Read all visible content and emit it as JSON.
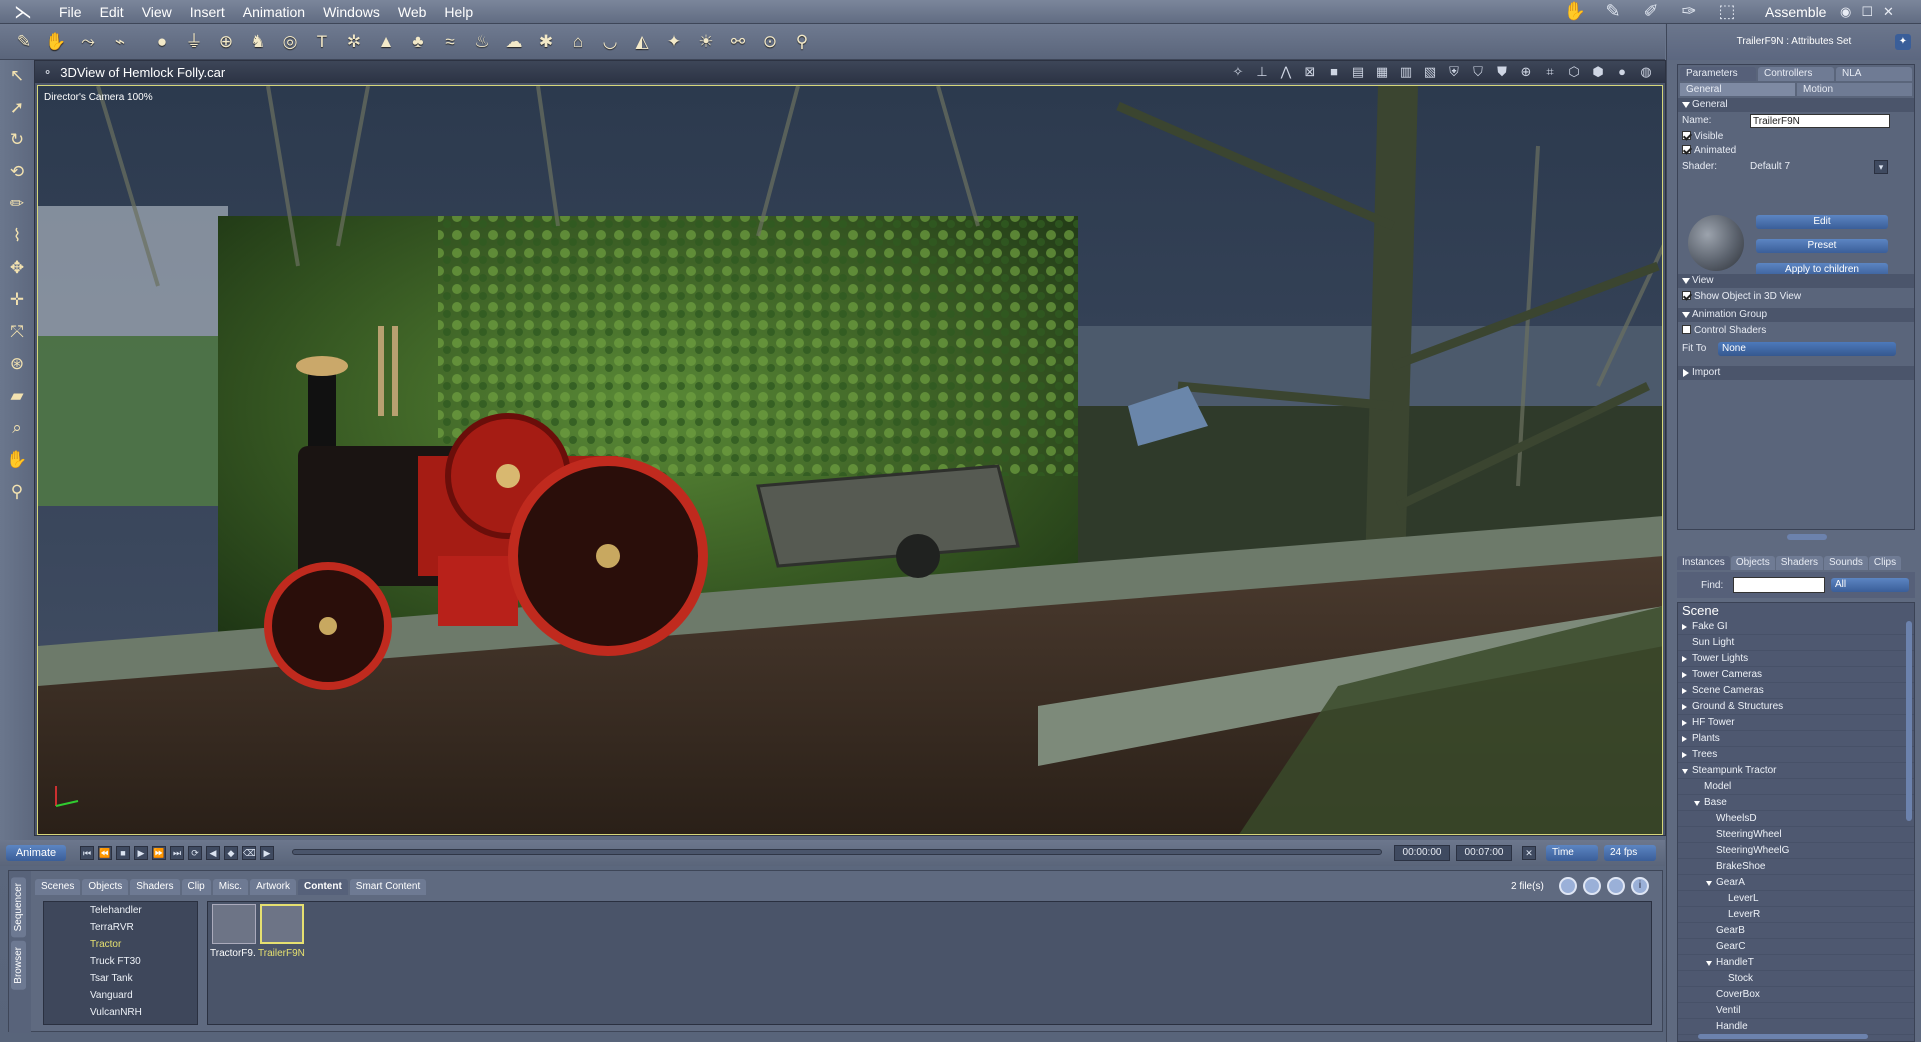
{
  "menu": {
    "items": [
      "File",
      "Edit",
      "View",
      "Insert",
      "Animation",
      "Windows",
      "Web",
      "Help"
    ],
    "room": "Assemble"
  },
  "viewport": {
    "title": "3DView of Hemlock Folly.car",
    "camera": "Director's Camera 100%"
  },
  "attributes": {
    "title": "TrailerF9N : Attributes Set",
    "tabs": [
      "Parameters",
      "Controllers",
      "NLA"
    ],
    "subtabs": [
      "General",
      "Motion"
    ],
    "general_section": "General",
    "name_label": "Name:",
    "name_value": "TrailerF9N",
    "visible_label": "Visible",
    "animated_label": "Animated",
    "shader_label": "Shader:",
    "shader_value": "Default 7",
    "edit_btn": "Edit",
    "preset_btn": "Preset",
    "apply_btn": "Apply to children",
    "view_section": "View",
    "show_object_label": "Show Object in 3D View",
    "anim_group_section": "Animation Group",
    "control_shaders_label": "Control Shaders",
    "fit_to_label": "Fit To",
    "fit_to_value": "None",
    "import_section": "Import"
  },
  "instances": {
    "tabs": [
      "Instances",
      "Objects",
      "Shaders",
      "Sounds",
      "Clips"
    ],
    "find_label": "Find:",
    "find_filter": "All",
    "scene_title": "Scene",
    "tree": [
      {
        "label": "Fake GI",
        "depth": 0,
        "arrow": "closed"
      },
      {
        "label": "Sun Light",
        "depth": 0,
        "arrow": "none"
      },
      {
        "label": "Tower Lights",
        "depth": 0,
        "arrow": "closed"
      },
      {
        "label": "Tower Cameras",
        "depth": 0,
        "arrow": "closed"
      },
      {
        "label": "Scene Cameras",
        "depth": 0,
        "arrow": "closed"
      },
      {
        "label": "Ground & Structures",
        "depth": 0,
        "arrow": "closed"
      },
      {
        "label": "HF Tower",
        "depth": 0,
        "arrow": "closed"
      },
      {
        "label": "Plants",
        "depth": 0,
        "arrow": "closed"
      },
      {
        "label": "Trees",
        "depth": 0,
        "arrow": "closed"
      },
      {
        "label": "Steampunk Tractor",
        "depth": 0,
        "arrow": "open"
      },
      {
        "label": "Model",
        "depth": 1,
        "arrow": "none"
      },
      {
        "label": "Base",
        "depth": 1,
        "arrow": "open"
      },
      {
        "label": "WheelsD",
        "depth": 2,
        "arrow": "none"
      },
      {
        "label": "SteeringWheel",
        "depth": 2,
        "arrow": "none"
      },
      {
        "label": "SteeringWheelG",
        "depth": 2,
        "arrow": "none"
      },
      {
        "label": "BrakeShoe",
        "depth": 2,
        "arrow": "none"
      },
      {
        "label": "GearA",
        "depth": 2,
        "arrow": "open"
      },
      {
        "label": "LeverL",
        "depth": 3,
        "arrow": "none"
      },
      {
        "label": "LeverR",
        "depth": 3,
        "arrow": "none"
      },
      {
        "label": "GearB",
        "depth": 2,
        "arrow": "none"
      },
      {
        "label": "GearC",
        "depth": 2,
        "arrow": "none"
      },
      {
        "label": "HandleT",
        "depth": 2,
        "arrow": "open"
      },
      {
        "label": "Stock",
        "depth": 3,
        "arrow": "none"
      },
      {
        "label": "CoverBox",
        "depth": 2,
        "arrow": "none"
      },
      {
        "label": "Ventil",
        "depth": 2,
        "arrow": "none"
      },
      {
        "label": "Handle",
        "depth": 2,
        "arrow": "none"
      }
    ]
  },
  "animbar": {
    "animate_btn": "Animate",
    "time_start": "00:00:00",
    "time_end": "00:07:00",
    "time_mode": "Time",
    "fps": "24 fps"
  },
  "browser": {
    "side_tabs": [
      "Sequencer",
      "Browser"
    ],
    "tabs": [
      "Scenes",
      "Objects",
      "Shaders",
      "Clip",
      "Misc.",
      "Artwork",
      "Content",
      "Smart Content"
    ],
    "active_tab": "Content",
    "file_count": "2 file(s)",
    "list": [
      "Telehandler",
      "TerraRVR",
      "Tractor",
      "Truck FT30",
      "Tsar Tank",
      "Vanguard",
      "VulcanNRH"
    ],
    "selected": "Tractor",
    "thumbs": [
      {
        "label": "TractorF9.",
        "sel": false
      },
      {
        "label": "TrailerF9N",
        "sel": true
      }
    ]
  },
  "colors": {
    "accent_blue": "#3a5e99",
    "selected_yellow": "#e6e070",
    "viewport_border": "#d6d67a"
  }
}
